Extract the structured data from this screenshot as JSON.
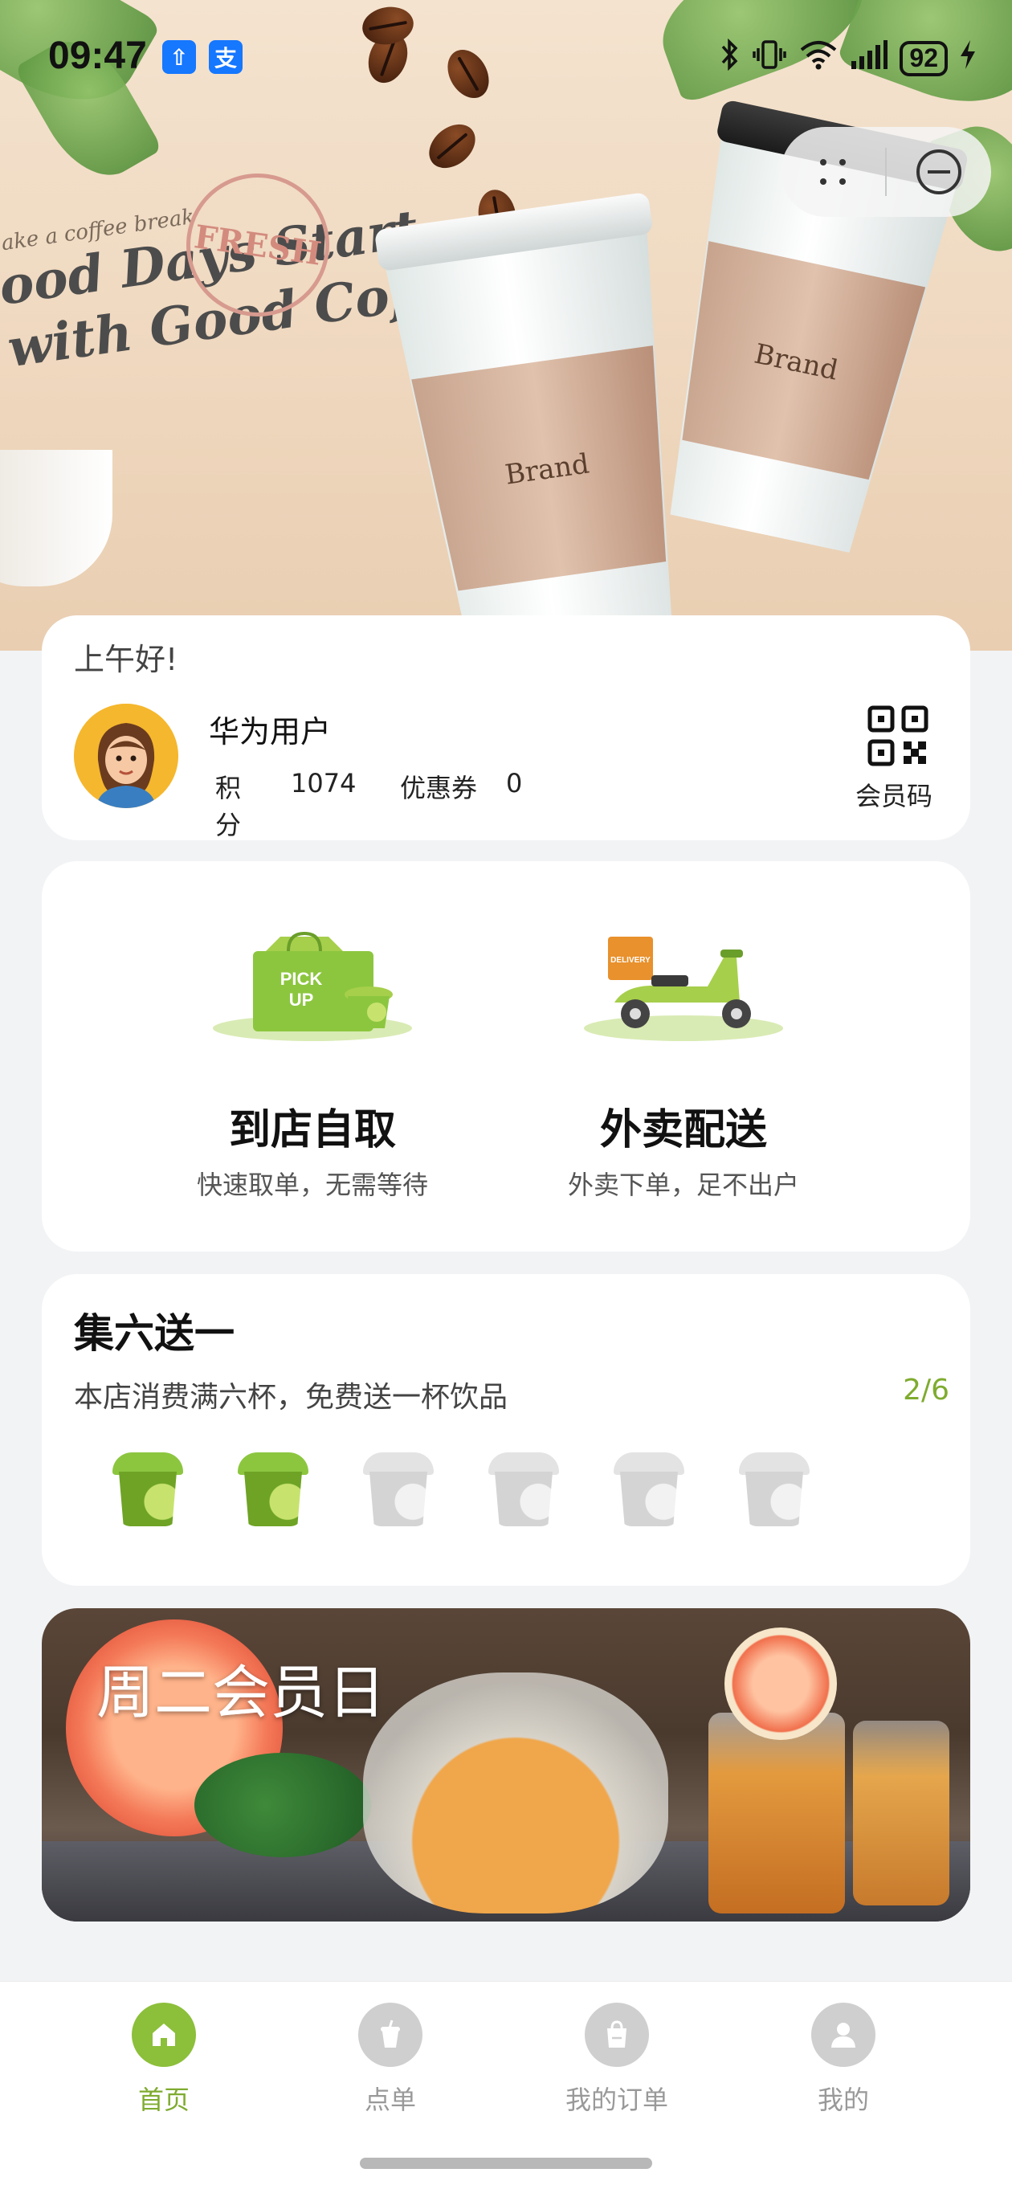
{
  "status_bar": {
    "time": "09:47",
    "app_icons": [
      "⇧",
      "支"
    ],
    "battery": "92"
  },
  "hero": {
    "tagline": "ake a coffee break",
    "headline_line1": "ood Days Start",
    "headline_line2": "with Good Coffee",
    "stamp_text": "FRESH",
    "cup_brand": "Brand"
  },
  "member": {
    "greeting": "上午好!",
    "username": "华为用户",
    "points_label": "积分",
    "points_value": "1074",
    "coupons_label": "优惠券",
    "coupons_value": "0",
    "qr_label": "会员码"
  },
  "services": [
    {
      "badge": "PICK UP",
      "title": "到店自取",
      "subtitle": "快速取单，无需等待"
    },
    {
      "badge": "DELIVERY",
      "title": "外卖配送",
      "subtitle": "外卖下单，足不出户"
    }
  ],
  "stamp_card": {
    "title": "集六送一",
    "description": "本店消费满六杯，免费送一杯饮品",
    "progress": "2/6",
    "collected": 2,
    "total": 6
  },
  "promo": {
    "title": "周二会员日"
  },
  "bottom_nav": [
    {
      "label": "首页",
      "icon": "home-icon",
      "active": true
    },
    {
      "label": "点单",
      "icon": "drink-cup-icon",
      "active": false
    },
    {
      "label": "我的订单",
      "icon": "shopping-bag-icon",
      "active": false
    },
    {
      "label": "我的",
      "icon": "person-icon",
      "active": false
    }
  ],
  "colors": {
    "accent_green": "#8cbf3a",
    "progress_green": "#7fab2f",
    "background": "#f2f3f5"
  }
}
